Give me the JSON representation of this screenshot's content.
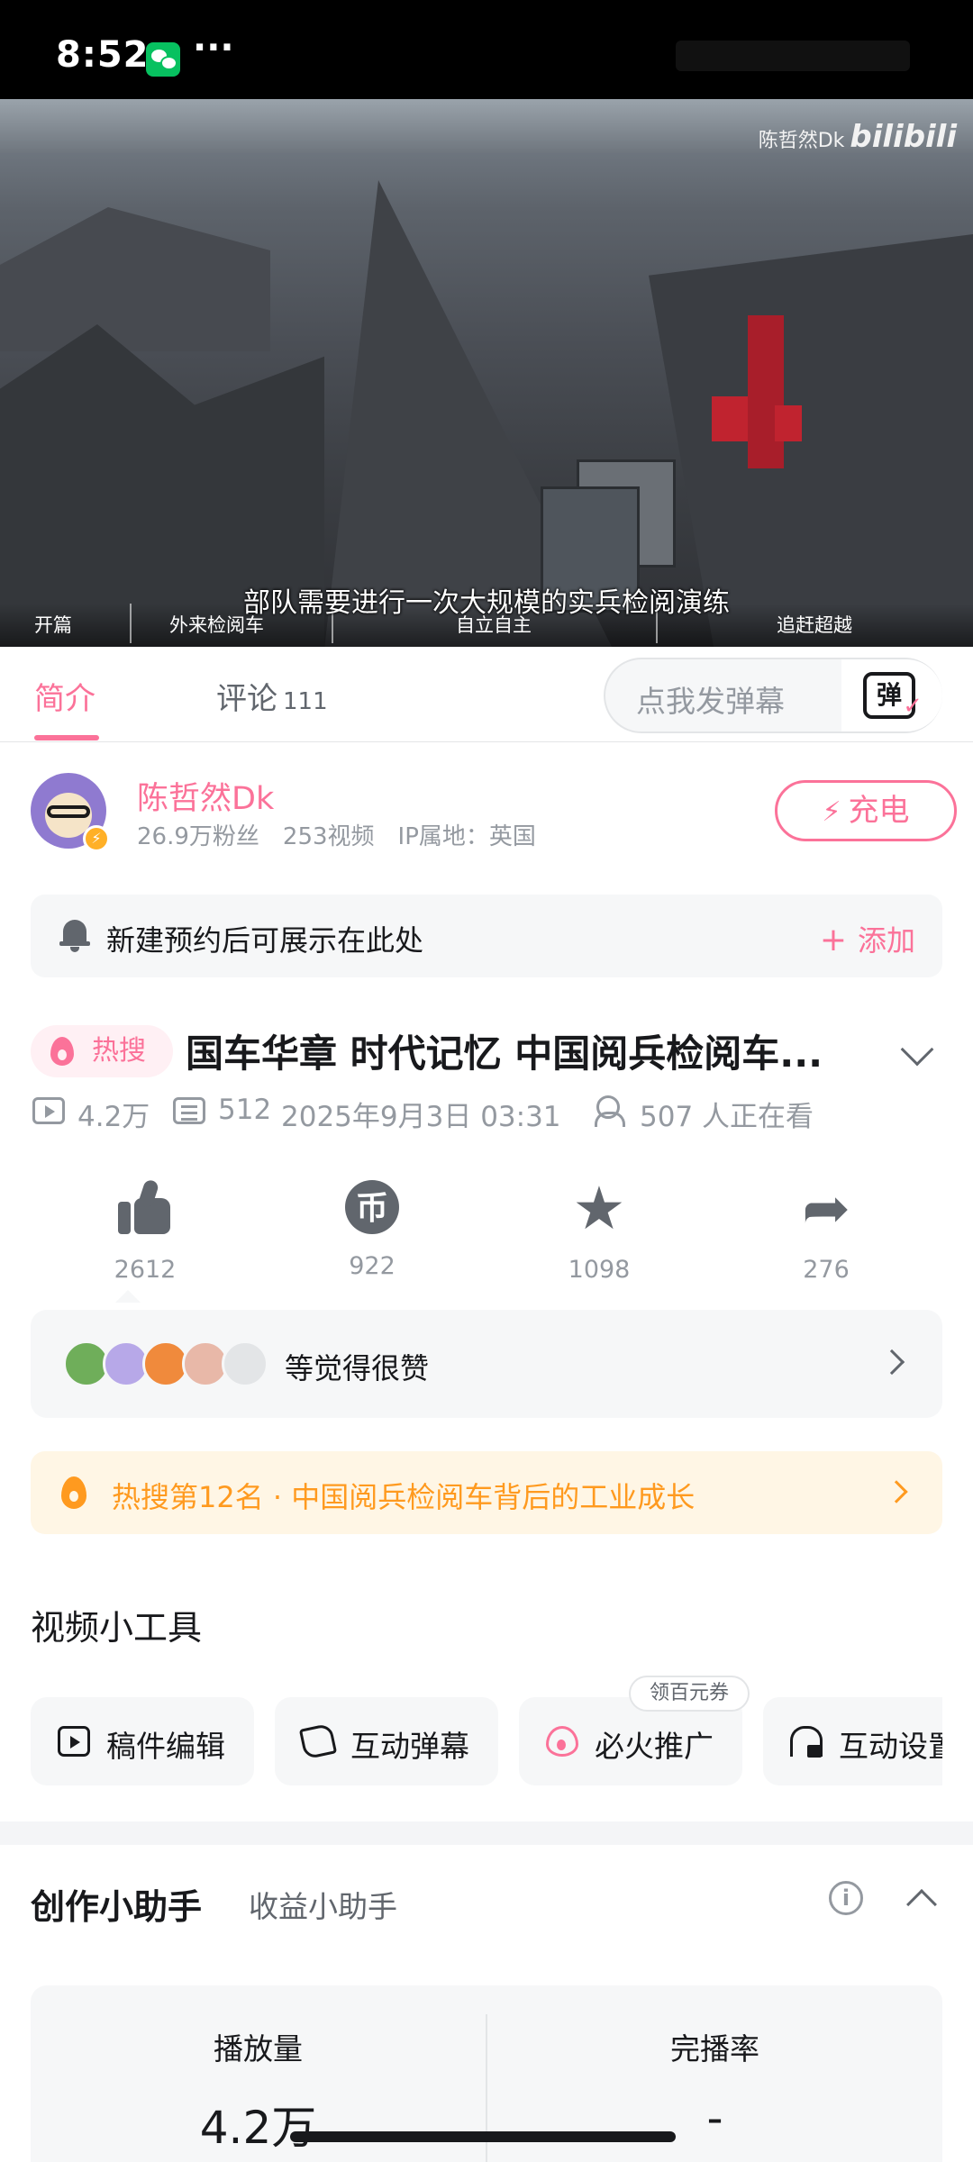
{
  "status_bar": {
    "time": "8:52",
    "more": "···"
  },
  "video": {
    "subtitle": "部队需要进行一次大规模的实兵检阅演练",
    "watermark_author": "陈哲然Dk",
    "watermark_logo": "bilibili",
    "chapters": [
      "开篇",
      "外来检阅车",
      "自立自主",
      "追赶超越"
    ]
  },
  "tabs": {
    "intro": "简介",
    "comments": "评论",
    "comments_count": "111",
    "danmaku_placeholder": "点我发弹幕",
    "danmaku_btn": "弹"
  },
  "uploader": {
    "name": "陈哲然Dk",
    "fans": "26.9万粉丝",
    "videos": "253视频",
    "ip": "IP属地：英国",
    "charge_label": "充电",
    "charge_icon": "⚡"
  },
  "reservation": {
    "text": "新建预约后可展示在此处",
    "add_label": "添加",
    "add_icon": "+"
  },
  "video_info": {
    "hot_tag": "热搜",
    "title": "国车华章 时代记忆 中国阅兵检阅车...",
    "plays": "4.2万",
    "danmaku_count": "512",
    "date": "2025年9月3日 03:31",
    "watching": "507 人正在看"
  },
  "actions": {
    "like": "2612",
    "coin": "922",
    "coin_glyph": "币",
    "favorite": "1098",
    "share": "276"
  },
  "likers": {
    "text": "等觉得很赞"
  },
  "hot_rank": {
    "text": "热搜第12名 · 中国阅兵检阅车背后的工业成长"
  },
  "tools": {
    "title": "视频小工具",
    "coupon": "领百元券",
    "items": [
      "稿件编辑",
      "互动弹幕",
      "必火推广",
      "互动设置"
    ]
  },
  "creator": {
    "title": "创作小助手",
    "subtitle": "收益小助手",
    "info_glyph": "i",
    "stats": [
      {
        "label": "播放量",
        "value": "4.2万"
      },
      {
        "label": "完播率",
        "value": "-"
      }
    ]
  },
  "colors": {
    "accent": "#fb7299",
    "hot": "#ff9a1f",
    "text": "#18191c",
    "muted": "#9499a0"
  }
}
